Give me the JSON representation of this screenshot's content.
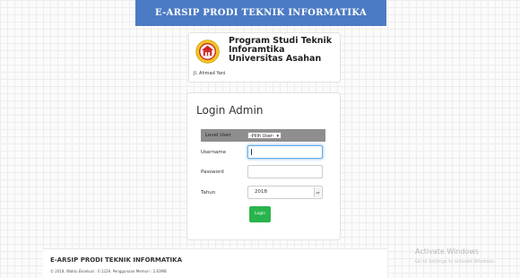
{
  "app": {
    "title": "E-ARSIP PRODI TEKNIK INFORMATIKA"
  },
  "header": {
    "logo_icon": "university-seal-logo",
    "org_name": "Program Studi Teknik Inforamtika Universitas Asahan",
    "address": "Jl. Ahmad Yani"
  },
  "login": {
    "title": "Login Admin",
    "level": {
      "label": "Level User",
      "selected": "-Pilih User-"
    },
    "username": {
      "label": "Username",
      "value": ""
    },
    "password": {
      "label": "Password",
      "value": ""
    },
    "year": {
      "label": "Tahun",
      "selected": "2018"
    },
    "submit_label": "Login",
    "colors": {
      "submit": "#28b44c",
      "topbar": "#4b7bc4"
    }
  },
  "footer": {
    "title": "E-ARSIP PRODI TEKNIK INFORMATIKA",
    "info": "© 2018, Waktu Eksekusi : 0.1229, Penggunaan Memori : 2.83MB"
  },
  "os_overlay": {
    "title": "Activate Windows",
    "subtitle": "Go to Settings to activate Windows."
  }
}
